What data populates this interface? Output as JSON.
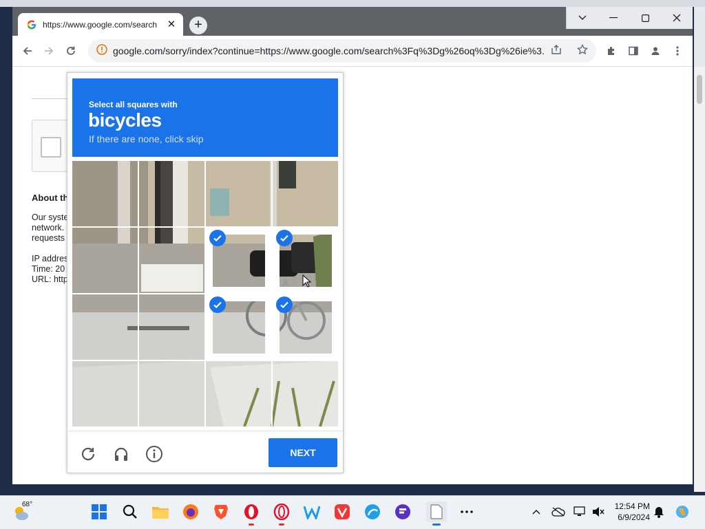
{
  "browser": {
    "tab_title": "https://www.google.com/search",
    "url": "google.com/sorry/index?continue=https://www.google.com/search%3Fq%3Dg%26oq%3Dg%26ie%3..."
  },
  "page": {
    "about_title": "About th",
    "body_lines": [
      "Our syste",
      "network.",
      "requests"
    ],
    "meta_lines": [
      "IP addres",
      "Time: 20",
      "URL: http"
    ]
  },
  "captcha": {
    "instruction": "Select all squares with",
    "object": "bicycles",
    "hint": "If there are none, click skip",
    "next_label": "NEXT",
    "selected_tiles": [
      6,
      7,
      10,
      11
    ],
    "accent_color": "#1a73e8"
  },
  "taskbar": {
    "temperature": "68°",
    "time": "12:54 PM",
    "date": "6/9/2024"
  }
}
